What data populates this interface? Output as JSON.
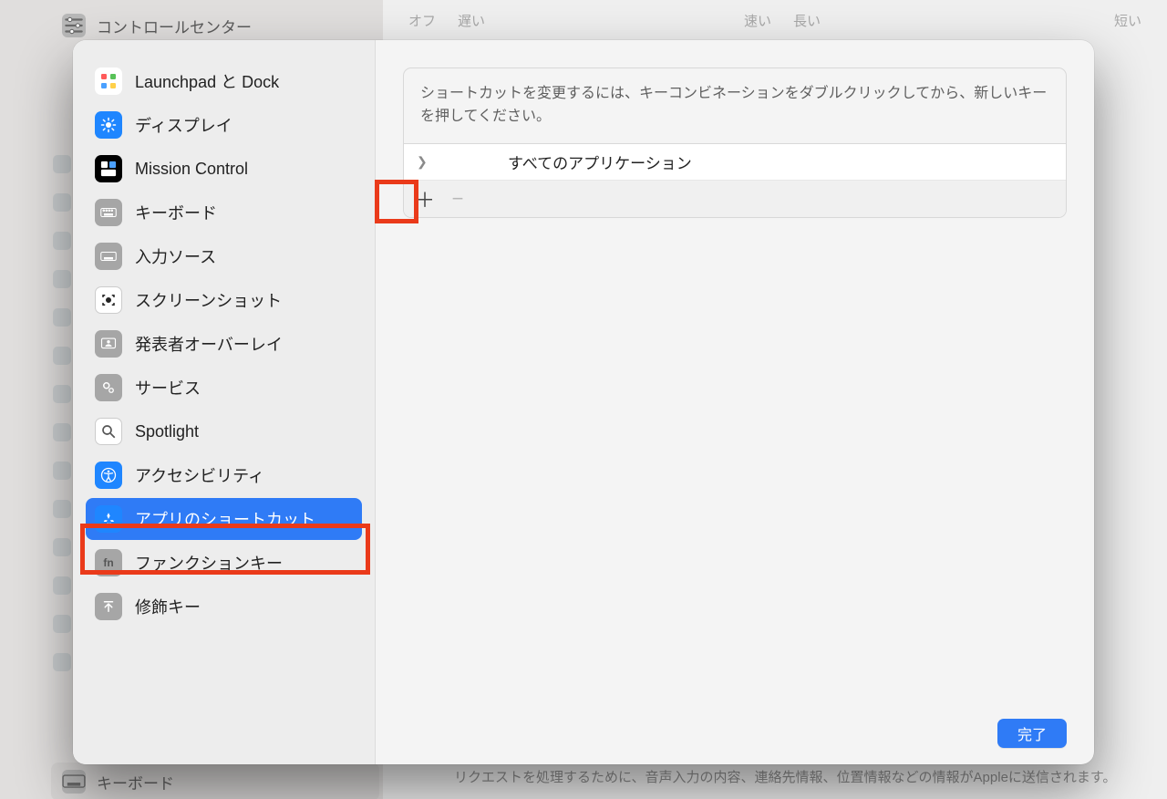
{
  "background": {
    "top_item": "コントロールセンター",
    "bottom_item": "キーボード",
    "slider_labels": {
      "off": "オフ",
      "slow": "遅い",
      "fast": "速い",
      "long": "長い",
      "short": "短い"
    },
    "footer_text": "リクエストを処理するために、音声入力の内容、連絡先情報、位置情報などの情報がAppleに送信されます。"
  },
  "sheet": {
    "sidebar": {
      "items": [
        {
          "id": "launchpad",
          "label": "Launchpad と Dock"
        },
        {
          "id": "display",
          "label": "ディスプレイ"
        },
        {
          "id": "mission",
          "label": "Mission Control"
        },
        {
          "id": "keyboard",
          "label": "キーボード"
        },
        {
          "id": "input",
          "label": "入力ソース"
        },
        {
          "id": "screenshot",
          "label": "スクリーンショット"
        },
        {
          "id": "presenter",
          "label": "発表者オーバーレイ"
        },
        {
          "id": "services",
          "label": "サービス"
        },
        {
          "id": "spotlight",
          "label": "Spotlight"
        },
        {
          "id": "a11y",
          "label": "アクセシビリティ"
        },
        {
          "id": "apps",
          "label": "アプリのショートカット"
        },
        {
          "id": "fn",
          "label": "ファンクションキー"
        },
        {
          "id": "modifier",
          "label": "修飾キー"
        }
      ],
      "selected_index": 10
    },
    "main": {
      "instruction": "ショートカットを変更するには、キーコンビネーションをダブルクリックしてから、新しいキーを押してください。",
      "rows": [
        {
          "label": "すべてのアプリケーション"
        }
      ],
      "toolbar": {
        "add": "＋",
        "remove": "−"
      },
      "done_label": "完了"
    }
  }
}
